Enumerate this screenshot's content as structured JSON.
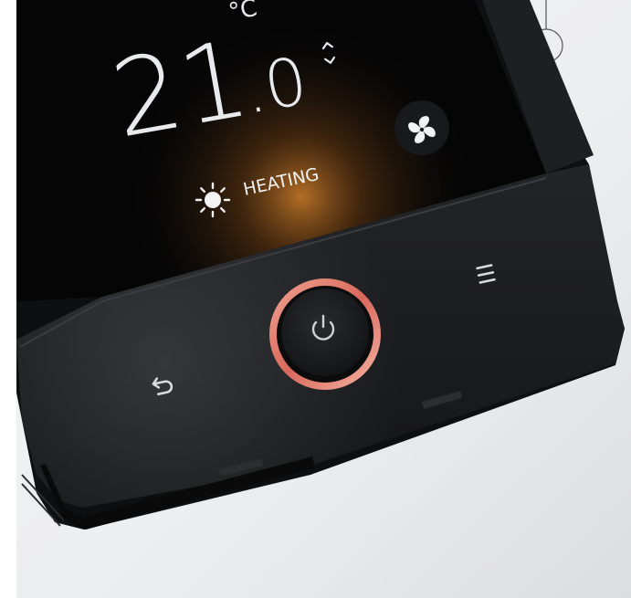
{
  "screen": {
    "temperature_integer": "21",
    "temperature_decimal": ".0",
    "unit": "°C",
    "mode_label": "HEATING"
  },
  "icons": {
    "sun": "sun-icon",
    "fan": "fan-icon",
    "updown": "up-down-arrows-icon",
    "power": "power-icon",
    "menu": "menu-icon",
    "back": "back-arrow-icon"
  },
  "colors": {
    "power_ring": "#e8897a",
    "screen_glow": "#b86a1e",
    "device_body": "#1b1c1e"
  }
}
